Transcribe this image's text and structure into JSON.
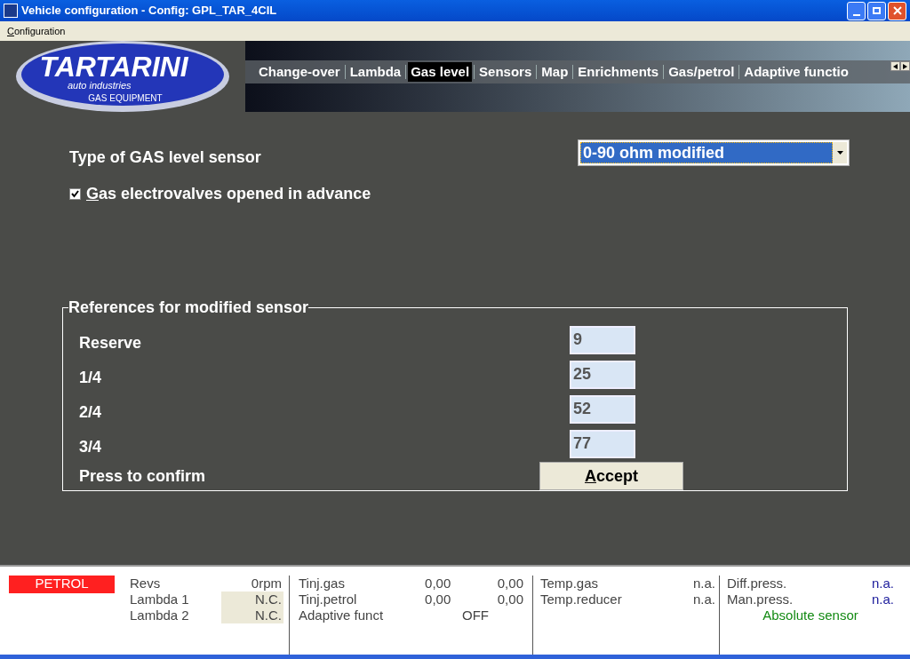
{
  "window": {
    "title": "Vehicle configuration - Config: GPL_TAR_4CIL"
  },
  "menu": [
    {
      "label": "Configuration"
    }
  ],
  "logo": {
    "name": "TARTARINI",
    "tagline": "auto industries",
    "subtitle": "GAS EQUIPMENT"
  },
  "tabs": [
    {
      "label": "Change-over",
      "selected": false
    },
    {
      "label": "Lambda",
      "selected": false
    },
    {
      "label": "Gas level",
      "selected": true
    },
    {
      "label": "Sensors",
      "selected": false
    },
    {
      "label": "Map",
      "selected": false
    },
    {
      "label": "Enrichments",
      "selected": false
    },
    {
      "label": "Gas/petrol",
      "selected": false
    },
    {
      "label": "Adaptive functio",
      "selected": false
    }
  ],
  "sensor_type": {
    "label": "Type of GAS level sensor",
    "value": "0-90 ohm modified"
  },
  "advance_checkbox": {
    "label": "Gas electrovalves opened in advance",
    "checked": true
  },
  "references": {
    "title": "References for modified sensor",
    "rows": [
      {
        "label": "Reserve",
        "value": "9"
      },
      {
        "label": "1/4",
        "value": "25"
      },
      {
        "label": "2/4",
        "value": "52"
      },
      {
        "label": "3/4",
        "value": "77"
      }
    ],
    "confirm_label": "Press to confirm",
    "button": {
      "label": "Accept"
    }
  },
  "status_bar": {
    "fuel": "PETROL",
    "col_1": [
      {
        "label": "Revs",
        "value": "0rpm",
        "boxed": false
      },
      {
        "label": "Lambda 1",
        "value": "N.C.",
        "boxed": true
      },
      {
        "label": "Lambda 2",
        "value": "N.C.",
        "boxed": true
      }
    ],
    "col_2": [
      {
        "label": "Tinj.gas",
        "values": [
          "0,00",
          "0,00"
        ]
      },
      {
        "label": "Tinj.petrol",
        "values": [
          "0,00",
          "0,00"
        ]
      },
      {
        "label": "Adaptive funct",
        "values": [
          "OFF"
        ]
      }
    ],
    "col_3": [
      {
        "label": "Temp.gas",
        "value": "n.a."
      },
      {
        "label": "Temp.reducer",
        "value": "n.a."
      }
    ],
    "col_4": [
      {
        "label": "Diff.press.",
        "value": "n.a."
      },
      {
        "label": "Man.press.",
        "value": "n.a."
      }
    ],
    "sensor_note": "Absolute sensor"
  }
}
